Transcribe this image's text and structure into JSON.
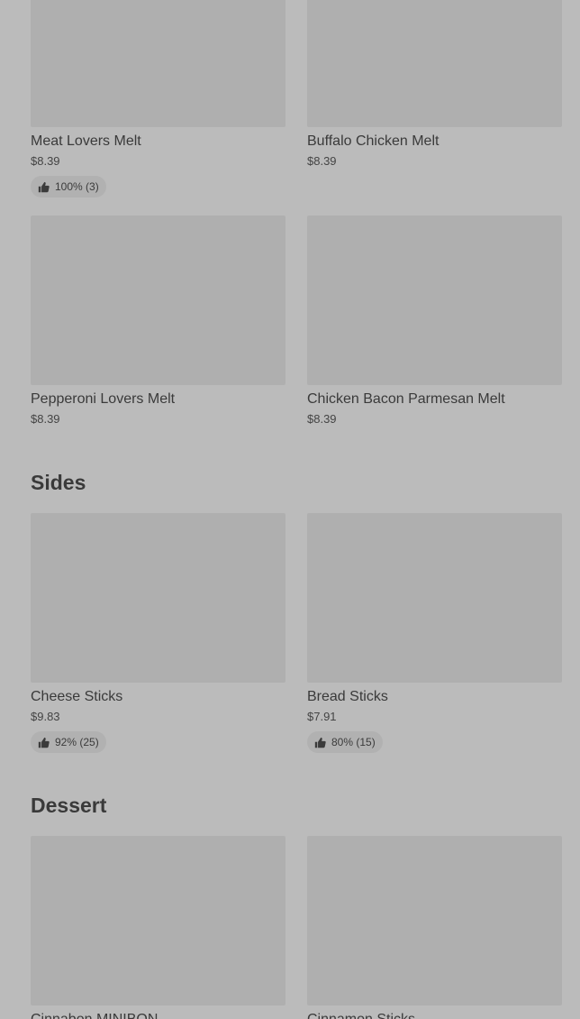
{
  "melts": [
    {
      "name": "Meat Lovers Melt",
      "price": "$8.39",
      "rating": "100% (3)"
    },
    {
      "name": "Buffalo Chicken Melt",
      "price": "$8.39"
    },
    {
      "name": "Pepperoni Lovers Melt",
      "price": "$8.39"
    },
    {
      "name": "Chicken Bacon Parmesan Melt",
      "price": "$8.39"
    }
  ],
  "sides": {
    "title": "Sides",
    "items": [
      {
        "name": "Cheese Sticks",
        "price": "$9.83",
        "rating": "92% (25)"
      },
      {
        "name": "Bread Sticks",
        "price": "$7.91",
        "rating": "80% (15)"
      }
    ]
  },
  "dessert": {
    "title": "Dessert",
    "items": [
      {
        "name": "Cinnabon MINIBON"
      },
      {
        "name": "Cinnamon Sticks"
      }
    ]
  }
}
